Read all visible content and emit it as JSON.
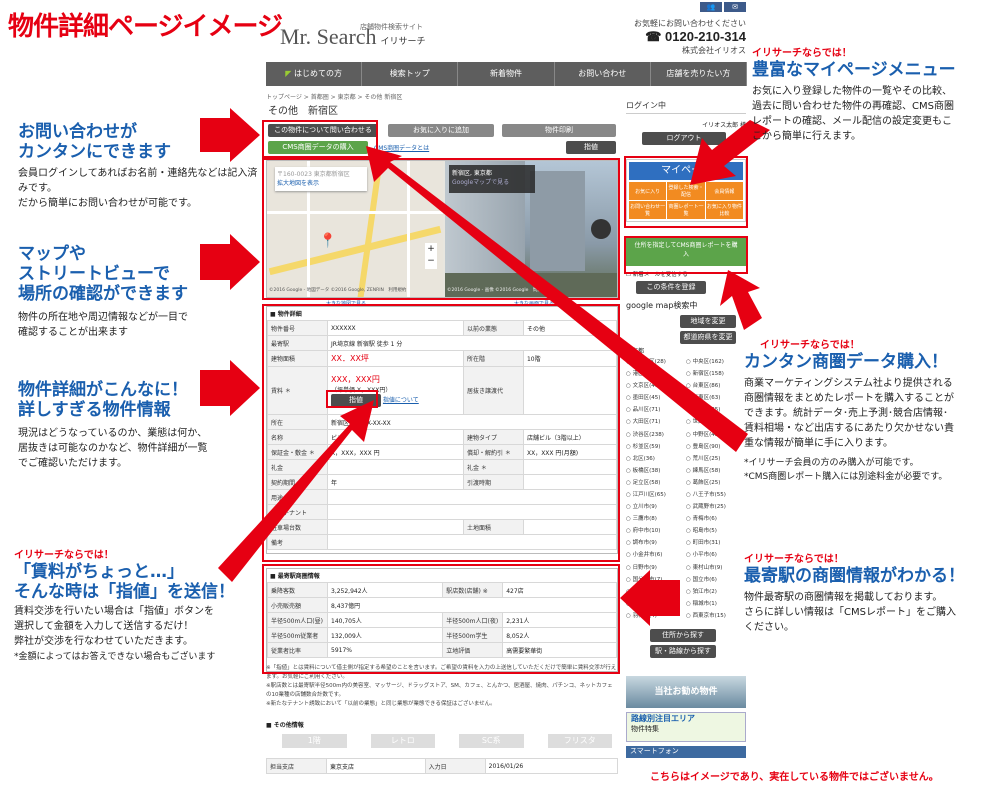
{
  "page_title": "物件詳細ページイメージ",
  "site": {
    "tagline": "店舗物件検索サイト",
    "logo_text": "Mr. Search",
    "logo_sub": "イリサーチ",
    "contact_note": "お気軽にお問い合わせください",
    "tel": "0120-210-314",
    "company": "株式会社イリオス"
  },
  "nav": [
    "はじめての方",
    "検索トップ",
    "新着物件",
    "お問い合わせ",
    "店舗を売りたい方"
  ],
  "breadcrumb": "トップページ > 首都圏 > 東京都 > その他 新宿区",
  "property_title": "その他　新宿区",
  "buttons": {
    "inquiry": "この物件について問い合わせる",
    "favorite": "お気に入りに追加",
    "print": "物件印刷",
    "cms_buy": "CMS商圏データの購入",
    "cms_about": "CMS商圏データとは",
    "sashine": "指値",
    "sashine2": "指値",
    "sashine_about": "指値について"
  },
  "map": {
    "expand": "拡大地図を表示",
    "streetview_label": "新宿区, 東京都",
    "gmaps_link": "Googleマップで見る",
    "map_credit": "©2016 Google - 地図データ ©2016 Google, ZENRIN　利用規約",
    "sv_credit": "©2016 Google - 画像 ©2016 Google　問題の報告",
    "map_large": "大きな地図で見る",
    "sv_large": "大きな画面で見る"
  },
  "details": {
    "header": "■ 物件詳細",
    "rows": [
      [
        "物件番号",
        "XXXXXX",
        "以前の業態",
        "その他"
      ],
      [
        "最寄駅",
        "JR埼京線 新宿駅 徒歩 1 分",
        "",
        ""
      ],
      [
        "建物面積",
        "XX．XX坪",
        "所在階",
        "10階"
      ],
      [
        "賃料 ＊",
        "XXX，XXX円",
        "居抜き譲渡代",
        ""
      ],
      [
        "所在",
        "新宿区西新宿X-XX-XX",
        "",
        ""
      ],
      [
        "名称",
        "ビル",
        "建物タイプ",
        "店舗ビル（3階以上）"
      ],
      [
        "保証金・敷金 ＊",
        "X，XXX，XXX 円",
        "償却・解約引 ＊",
        "XX，XXX 円(月額)"
      ],
      [
        "礼金",
        "",
        "礼金 ＊",
        ""
      ],
      [
        "契約期間",
        "年",
        "引渡時期",
        ""
      ],
      [
        "用途",
        "",
        "",
        ""
      ],
      [
        "入居テナント",
        "",
        "",
        ""
      ],
      [
        "駐車場台数",
        "",
        "土地面積",
        ""
      ],
      [
        "備考",
        "",
        "",
        ""
      ]
    ],
    "rent_sub": "（坪単価 X，XXX円）"
  },
  "trade": {
    "header": "■ 最寄駅商圏情報",
    "rows": [
      [
        "乗降客数",
        "3,252,942人",
        "駅店数(店舗) ※",
        "427店"
      ],
      [
        "小売販売額",
        "8,437億円",
        "",
        ""
      ],
      [
        "半径500m人口(昼)",
        "140,705人",
        "半径500m人口(夜)",
        "2,231人"
      ],
      [
        "半径500m従業者",
        "132,009人",
        "半径500m学生",
        "8,052人"
      ],
      [
        "従業者比率",
        "5917%",
        "立地評価",
        "高需要繁華街"
      ]
    ]
  },
  "footnotes": [
    "※「指値」とは賃料について借主側が指定する希望のことを言います。ご希望の賃料を入力の上送信していただくだけで簡単に賃料交渉が行えます。お気軽にご利用ください。",
    "※駅店数とは最寄駅半径500m内の美容室、マッサージ、ドラッグストア、SM、カフェ、とんかつ、居酒屋、焼肉、パチンコ、ネットカフェの10業種の店舗数合計数です。",
    "※新たなテナント誘致において「以前の業態」と同じ業態が業態できる保証はございません。"
  ],
  "other": {
    "header": "■ その他情報",
    "tags": [
      "1階",
      "レトロ",
      "SC系",
      "フリスタ"
    ],
    "rows": [
      [
        "担当支店",
        "東京支店",
        "入力日",
        "2016/01/26"
      ]
    ]
  },
  "sidebar": {
    "login_status": "ログイン中",
    "user": "イリオス太郎 様",
    "logout": "ログアウト",
    "mypage": "マイページ",
    "mypage_items": [
      "お気に入り",
      "登録した検索・配信",
      "会員情報",
      "お問い合わせ一覧",
      "商圏レポート一覧",
      "お気に入り物件比較"
    ],
    "cms_report": "住所を指定してCMS商圏レポートを購入",
    "new_mail": "新着メールを受信する",
    "save_search": "この条件を登録",
    "gmap_search": "google map検索中",
    "change_area": "地域を変更",
    "change_town": "都道府県を変更",
    "area_label": "東京都",
    "areas": [
      "千代田区(28)",
      "中央区(162)",
      "港区(246)",
      "新宿区(158)",
      "文京区(40)",
      "台東区(86)",
      "墨田区(45)",
      "江東区(63)",
      "品川区(71)",
      "目黒区(65)",
      "大田区(71)",
      "世田谷区(130)",
      "渋谷区(238)",
      "中野区(45)",
      "杉並区(59)",
      "豊島区(90)",
      "北区(36)",
      "荒川区(25)",
      "板橋区(38)",
      "練馬区(58)",
      "足立区(58)",
      "葛飾区(25)",
      "江戸川区(65)",
      "八王子市(55)",
      "立川市(9)",
      "武蔵野市(25)",
      "三鷹市(8)",
      "青梅市(6)",
      "府中市(10)",
      "昭島市(5)",
      "調布市(9)",
      "町田市(31)",
      "小金井市(6)",
      "小平市(6)",
      "日野市(9)",
      "東村山市(9)",
      "国分寺市(7)",
      "国立市(6)",
      "福生市(3)",
      "狛江市(2)",
      "清瀬市(15)",
      "稲城市(1)",
      "羽村市(4)",
      "西東京市(15)"
    ],
    "search_by_address": "住所から探す",
    "search_by_station": "駅・路線から探す",
    "banner1": "当社お勧め物件",
    "banner2a": "路線別注目エリア",
    "banner2b": "物件特集",
    "banner3": "スマートフォン"
  },
  "callouts": {
    "c1_title": "お問い合わせが\nカンタンにできます",
    "c1_body": "会員ログインしてあればお名前・連絡先などは記入済みです。\nだから簡単にお問い合わせが可能です。",
    "c2_title": "マップや\nストリートビューで\n場所の確認ができます",
    "c2_body": "物件の所在地や周辺情報などが一目で\n確認することが出来ます",
    "c3_title": "物件詳細がこんなに！\n詳しすぎる物件情報",
    "c3_body": "現況はどうなっているのか、業態は何か、\n居抜きは可能なのかなど、物件詳細が一覧\nでご確認いただけます。",
    "c4_kicker": "イリサーチならでは！",
    "c4_title": "「賃料がちょっと…」\nそんな時は「指値」を送信！",
    "c4_body": "賃料交渉を行いたい場合は「指値」ボタンを\n選択して金額を入力して送信するだけ！\n弊社が交渉を行なわせていただきます。",
    "c4_note": "*金額によってはお答えできない場合もございます",
    "c5_kicker": "イリサーチならでは！",
    "c5_title": "豊富なマイページメニュー",
    "c5_body": "お気に入り登録した物件の一覧やその比較、\n過去に問い合わせた物件の再確認、CMS商圏\nレポートの確認、メール配信の設定変更もこ\nこから簡単に行えます。",
    "c6_kicker": "イリサーチならでは！",
    "c6_title": "カンタン商圏データ購入！",
    "c6_body": "商業マーケティングシステム社より提供される\n商圏情報をまとめたレポートを購入することが\nできます。統計データ･売上予測･競合店情報･\n賃料相場・など出店するにあたり欠かせない貴\n重な情報が簡単に手に入ります。",
    "c6_note1": "*イリサーチ会員の方のみ購入が可能です。",
    "c6_note2": "*CMS商圏レポート購入には別途料金が必要です。",
    "c7_kicker": "イリサーチならでは！",
    "c7_title": "最寄駅の商圏情報がわかる！",
    "c7_body": "物件最寄駅の商圏情報を掲載しております。\nさらに詳しい情報は「CMSレポート」をご購入\nください。",
    "disclaimer": "こちらはイメージであり、実在している物件ではございません。"
  }
}
